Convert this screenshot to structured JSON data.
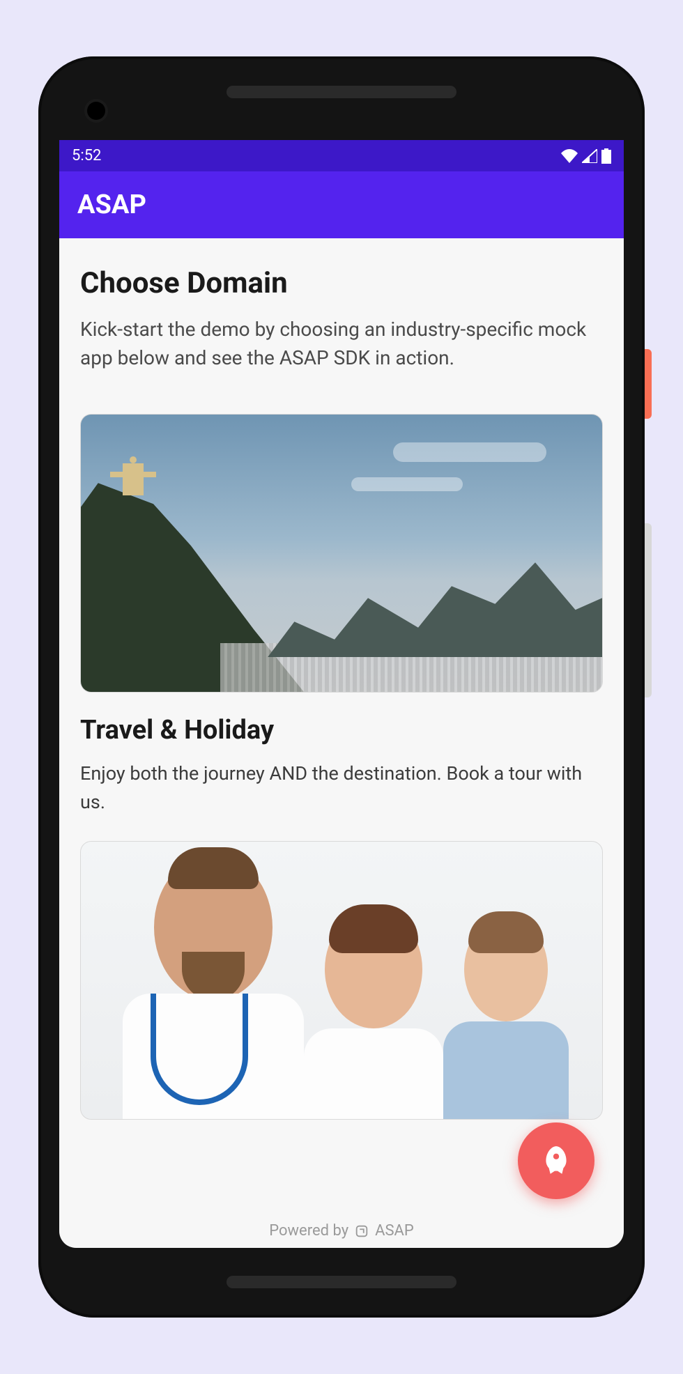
{
  "status": {
    "time": "5:52"
  },
  "app": {
    "title": "ASAP"
  },
  "page": {
    "title": "Choose Domain",
    "subtitle": "Kick-start the demo by choosing an industry-specific mock app below and see the ASAP SDK in action."
  },
  "cards": [
    {
      "id": "travel",
      "title": "Travel & Holiday",
      "desc": "Enjoy both the journey AND the destination. Book a tour with us."
    },
    {
      "id": "health",
      "title": "",
      "desc": ""
    }
  ],
  "footer": {
    "prefix": "Powered by",
    "brand": "ASAP"
  },
  "fab": {
    "icon": "rocket-icon"
  }
}
